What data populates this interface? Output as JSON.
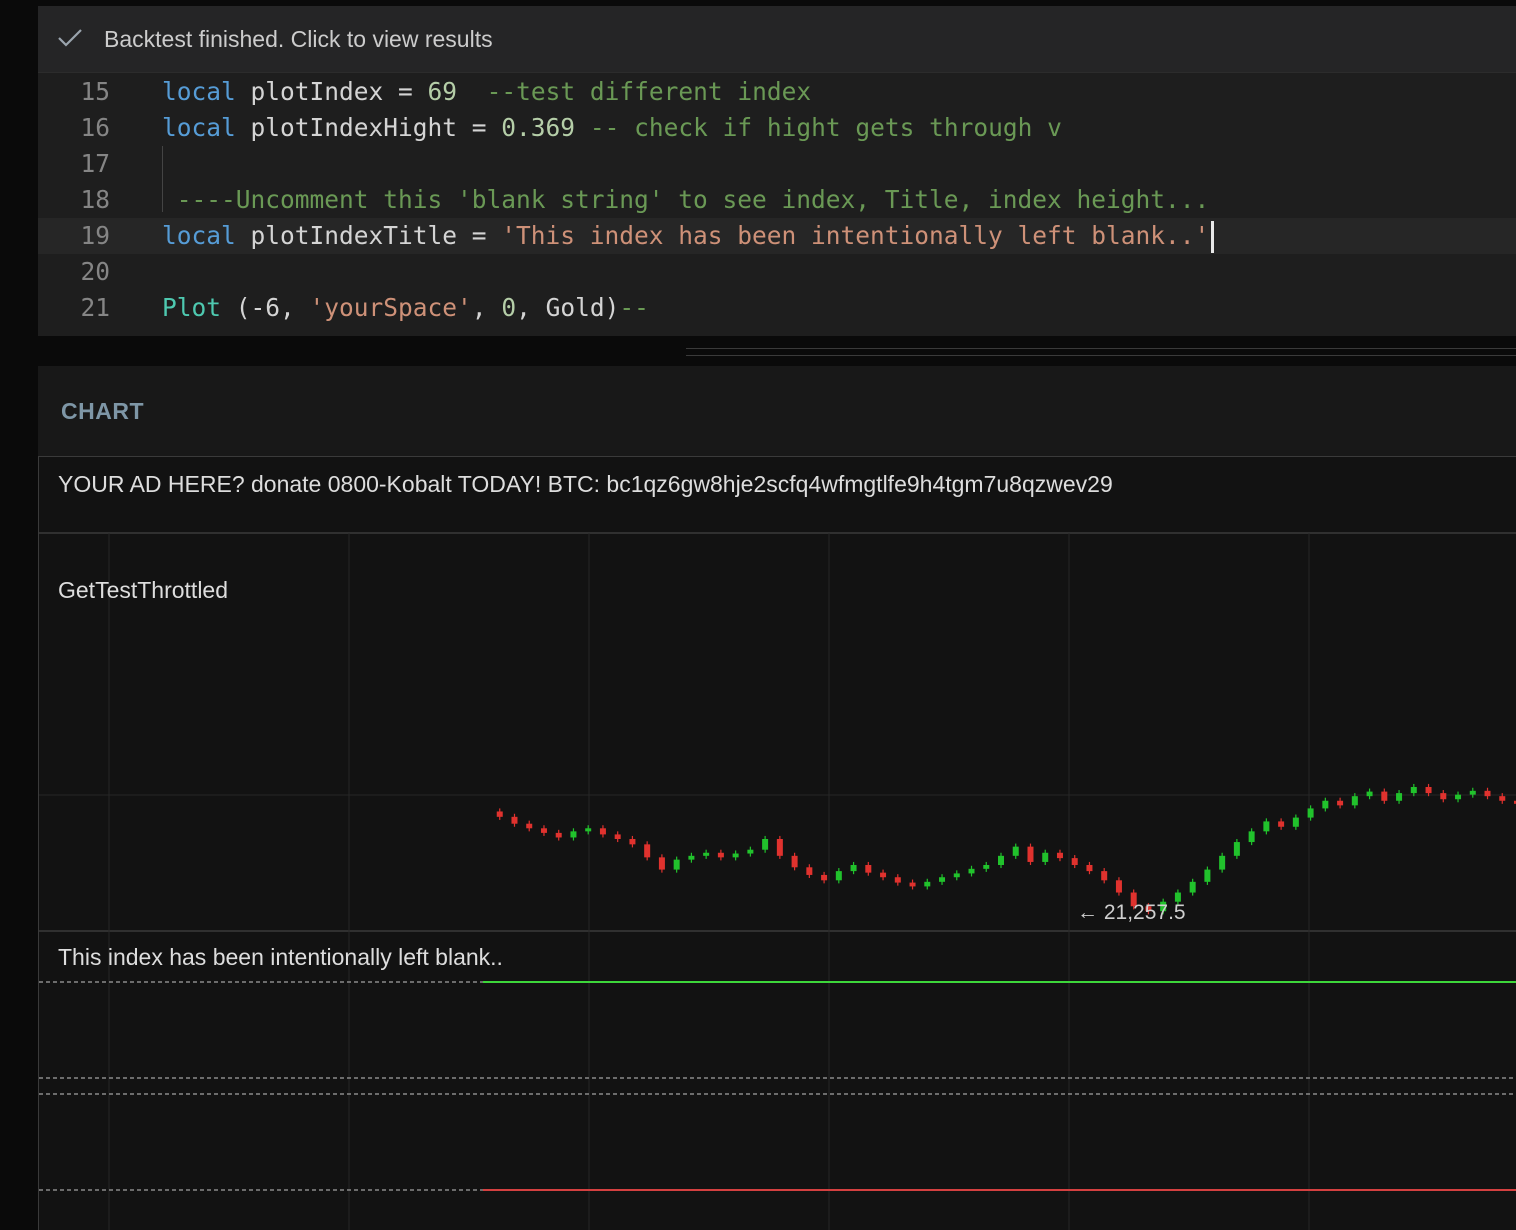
{
  "notification": {
    "message": "Backtest finished. Click to view results",
    "icon": "check-icon"
  },
  "editor": {
    "lines": [
      {
        "n": "15",
        "tokens": [
          [
            "kw",
            "local"
          ],
          [
            "id",
            " plotIndex "
          ],
          [
            "op",
            "="
          ],
          [
            "num",
            " 69"
          ],
          [
            "cm",
            "  --test different index"
          ]
        ]
      },
      {
        "n": "16",
        "tokens": [
          [
            "kw",
            "local"
          ],
          [
            "id",
            " plotIndexHight "
          ],
          [
            "op",
            "="
          ],
          [
            "num",
            " 0.369"
          ],
          [
            "cm",
            " -- check if hight gets through v"
          ]
        ]
      },
      {
        "n": "17",
        "tokens": []
      },
      {
        "n": "18",
        "tokens": [
          [
            "cm",
            " ----Uncomment this 'blank string' to see index, Title, index height..."
          ]
        ]
      },
      {
        "n": "19",
        "tokens": [
          [
            "kw",
            "local"
          ],
          [
            "id",
            " plotIndexTitle "
          ],
          [
            "op",
            "="
          ],
          [
            "str",
            " 'This index has been intentionally left blank..'"
          ]
        ],
        "active": true
      },
      {
        "n": "20",
        "tokens": []
      },
      {
        "n": "21",
        "tokens": [
          [
            "fn",
            "Plot"
          ],
          [
            "id",
            " (-6, "
          ],
          [
            "str",
            "'yourSpace'"
          ],
          [
            "id",
            ", "
          ],
          [
            "num",
            "0"
          ],
          [
            "id",
            ", Gold)"
          ],
          [
            "cm",
            "--"
          ]
        ]
      }
    ]
  },
  "chart": {
    "header": "CHART",
    "ad_text": "YOUR AD HERE? donate 0800-Kobalt TODAY! BTC: bc1qz6gw8hje2scfq4wfmgtlfe9h4tgm7u8qzwev29",
    "series_label": "GetTestThrottled",
    "index_label": "This index has been intentionally left blank..",
    "last_price": "21,257.5",
    "colors": {
      "up": "#21c22c",
      "down": "#e0322e",
      "upper_line": "#3dd63a",
      "lower_line": "#d44040"
    }
  },
  "chart_data": {
    "type": "line",
    "series": [
      {
        "values": [
          21388,
          21381,
          21372,
          21366,
          21360,
          21354,
          21362,
          21366,
          21358,
          21352,
          21345,
          21328,
          21312,
          21325,
          21330,
          21334,
          21328,
          21333,
          21338,
          21352,
          21330,
          21315,
          21305,
          21298,
          21310,
          21318,
          21308,
          21302,
          21295,
          21290,
          21296,
          21302,
          21307,
          21313,
          21318,
          21330,
          21342,
          21322,
          21334,
          21327,
          21318,
          21310,
          21298,
          21282,
          21264,
          21257.5,
          21270,
          21282,
          21296,
          21312,
          21330,
          21348,
          21362,
          21375,
          21368,
          21380,
          21392,
          21402,
          21396,
          21408,
          21414,
          21402,
          21412,
          21420,
          21412,
          21404,
          21410,
          21415,
          21408,
          21402,
          21398
        ]
      }
    ]
  }
}
